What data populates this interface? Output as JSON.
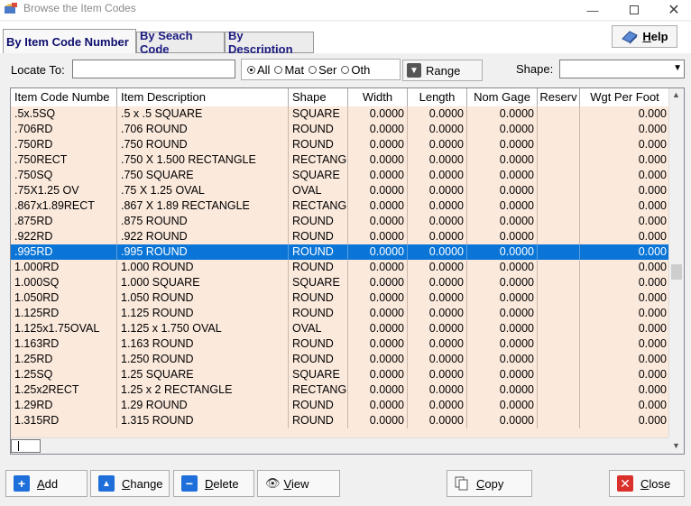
{
  "window": {
    "title": "Browse the Item Codes"
  },
  "tabs": [
    {
      "label": "By Item Code Number",
      "active": true
    },
    {
      "label": "By Seach Code",
      "active": false
    },
    {
      "label": "By Description",
      "active": false
    }
  ],
  "help": {
    "label_underlined": "H",
    "label_rest": "elp"
  },
  "locate": {
    "label": "Locate To:",
    "value": ""
  },
  "filters": {
    "all": "All",
    "mat": "Mat",
    "ser": "Ser",
    "oth": "Oth",
    "selected": "All"
  },
  "range": {
    "label": "Range"
  },
  "shape_filter": {
    "label": "Shape:",
    "value": ""
  },
  "grid": {
    "columns": [
      "Item Code Numbe",
      "Item Description",
      "Shape",
      "Width",
      "Length",
      "Nom Gage",
      "Reserv",
      "Wgt Per Foot"
    ],
    "selected_row": 9,
    "rows": [
      [
        ".5x.5SQ",
        ".5 x .5 SQUARE",
        "SQUARE",
        "0.0000",
        "0.0000",
        "0.0000",
        "",
        "0.000"
      ],
      [
        ".706RD",
        ".706 ROUND",
        "ROUND",
        "0.0000",
        "0.0000",
        "0.0000",
        "",
        "0.000"
      ],
      [
        ".750RD",
        ".750 ROUND",
        "ROUND",
        "0.0000",
        "0.0000",
        "0.0000",
        "",
        "0.000"
      ],
      [
        ".750RECT",
        ".750 X 1.500 RECTANGLE",
        "RECTANGLE",
        "0.0000",
        "0.0000",
        "0.0000",
        "",
        "0.000"
      ],
      [
        ".750SQ",
        ".750 SQUARE",
        "SQUARE",
        "0.0000",
        "0.0000",
        "0.0000",
        "",
        "0.000"
      ],
      [
        ".75X1.25 OV",
        ".75 X 1.25 OVAL",
        "OVAL",
        "0.0000",
        "0.0000",
        "0.0000",
        "",
        "0.000"
      ],
      [
        ".867x1.89RECT",
        ".867 X 1.89 RECTANGLE",
        "RECTANGLE",
        "0.0000",
        "0.0000",
        "0.0000",
        "",
        "0.000"
      ],
      [
        ".875RD",
        ".875 ROUND",
        "ROUND",
        "0.0000",
        "0.0000",
        "0.0000",
        "",
        "0.000"
      ],
      [
        ".922RD",
        ".922 ROUND",
        "ROUND",
        "0.0000",
        "0.0000",
        "0.0000",
        "",
        "0.000"
      ],
      [
        ".995RD",
        ".995 ROUND",
        "ROUND",
        "0.0000",
        "0.0000",
        "0.0000",
        "",
        "0.000"
      ],
      [
        "1.000RD",
        "1.000 ROUND",
        "ROUND",
        "0.0000",
        "0.0000",
        "0.0000",
        "",
        "0.000"
      ],
      [
        "1.000SQ",
        "1.000 SQUARE",
        "SQUARE",
        "0.0000",
        "0.0000",
        "0.0000",
        "",
        "0.000"
      ],
      [
        "1.050RD",
        "1.050 ROUND",
        "ROUND",
        "0.0000",
        "0.0000",
        "0.0000",
        "",
        "0.000"
      ],
      [
        "1.125RD",
        "1.125 ROUND",
        "ROUND",
        "0.0000",
        "0.0000",
        "0.0000",
        "",
        "0.000"
      ],
      [
        "1.125x1.75OVAL",
        "1.125 x 1.750 OVAL",
        "OVAL",
        "0.0000",
        "0.0000",
        "0.0000",
        "",
        "0.000"
      ],
      [
        "1.163RD",
        "1.163 ROUND",
        "ROUND",
        "0.0000",
        "0.0000",
        "0.0000",
        "",
        "0.000"
      ],
      [
        "1.25RD",
        "1.250 ROUND",
        "ROUND",
        "0.0000",
        "0.0000",
        "0.0000",
        "",
        "0.000"
      ],
      [
        "1.25SQ",
        "1.25 SQUARE",
        "SQUARE",
        "0.0000",
        "0.0000",
        "0.0000",
        "",
        "0.000"
      ],
      [
        "1.25x2RECT",
        "1.25 x 2 RECTANGLE",
        "RECTANGLE",
        "0.0000",
        "0.0000",
        "0.0000",
        "",
        "0.000"
      ],
      [
        "1.29RD",
        "1.29 ROUND",
        "ROUND",
        "0.0000",
        "0.0000",
        "0.0000",
        "",
        "0.000"
      ],
      [
        "1.315RD",
        "1.315 ROUND",
        "ROUND",
        "0.0000",
        "0.0000",
        "0.0000",
        "",
        "0.000"
      ]
    ]
  },
  "buttons": {
    "add": {
      "u": "A",
      "rest": "dd"
    },
    "change": {
      "u": "C",
      "rest": "hange"
    },
    "delete": {
      "u": "D",
      "rest": "elete"
    },
    "view": {
      "u": "V",
      "rest": "iew"
    },
    "copy": {
      "u": "C",
      "rest": "opy"
    },
    "close": {
      "u": "C",
      "rest": "lose"
    }
  },
  "colors": {
    "selection": "#0a75d7",
    "row_bg": "#fbe9dc",
    "add_icon": "#1e6fd9",
    "close_icon": "#d9302c"
  }
}
